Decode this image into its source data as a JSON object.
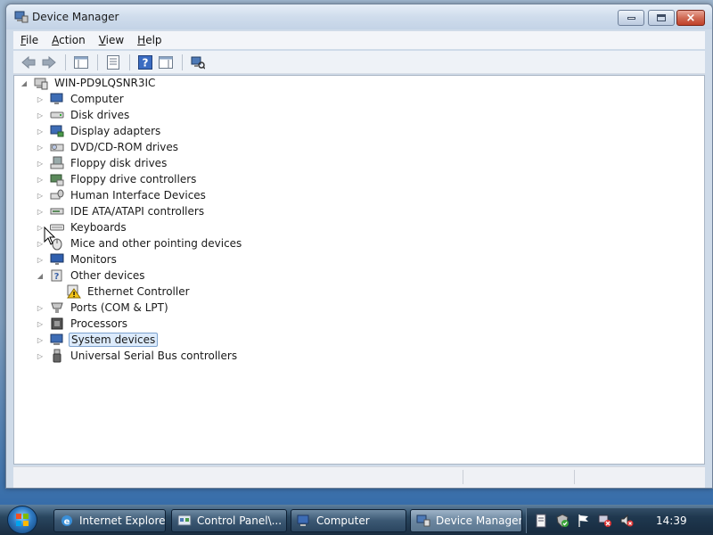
{
  "window": {
    "title": "Device Manager",
    "buttons": {
      "minimize": "minimize",
      "maximize": "maximize",
      "close": "×"
    }
  },
  "menu": [
    {
      "key": "F",
      "rest": "ile"
    },
    {
      "key": "A",
      "rest": "ction"
    },
    {
      "key": "V",
      "rest": "iew"
    },
    {
      "key": "H",
      "rest": "elp"
    }
  ],
  "tree": {
    "root": "WIN-PD9LQSNR3IC",
    "items": [
      {
        "label": "Computer",
        "icon": "computer-icon"
      },
      {
        "label": "Disk drives",
        "icon": "disk-drive-icon"
      },
      {
        "label": "Display adapters",
        "icon": "display-adapter-icon"
      },
      {
        "label": "DVD/CD-ROM drives",
        "icon": "dvd-drive-icon"
      },
      {
        "label": "Floppy disk drives",
        "icon": "floppy-drive-icon"
      },
      {
        "label": "Floppy drive controllers",
        "icon": "floppy-controller-icon"
      },
      {
        "label": "Human Interface Devices",
        "icon": "hid-icon"
      },
      {
        "label": "IDE ATA/ATAPI controllers",
        "icon": "ide-controller-icon"
      },
      {
        "label": "Keyboards",
        "icon": "keyboard-icon"
      },
      {
        "label": "Mice and other pointing devices",
        "icon": "mouse-icon"
      },
      {
        "label": "Monitors",
        "icon": "monitor-icon"
      },
      {
        "label": "Other devices",
        "icon": "other-devices-icon"
      },
      {
        "label": "Ethernet Controller",
        "icon": "warning-device-icon"
      },
      {
        "label": "Ports (COM & LPT)",
        "icon": "port-icon"
      },
      {
        "label": "Processors",
        "icon": "processor-icon"
      },
      {
        "label": "System devices",
        "icon": "system-devices-icon"
      },
      {
        "label": "Universal Serial Bus controllers",
        "icon": "usb-icon"
      }
    ]
  },
  "taskbar": {
    "buttons": [
      {
        "label": "Internet Explore...",
        "icon": "ie-icon"
      },
      {
        "label": "Control Panel\\...",
        "icon": "control-panel-icon"
      },
      {
        "label": "Computer",
        "icon": "computer-icon"
      },
      {
        "label": "Device Manager",
        "icon": "device-manager-icon"
      }
    ],
    "clock": "14:39"
  },
  "colors": {
    "selection_bg": "#dcebfc",
    "selection_border": "#7da2ce",
    "taskbar": "#29465f"
  }
}
